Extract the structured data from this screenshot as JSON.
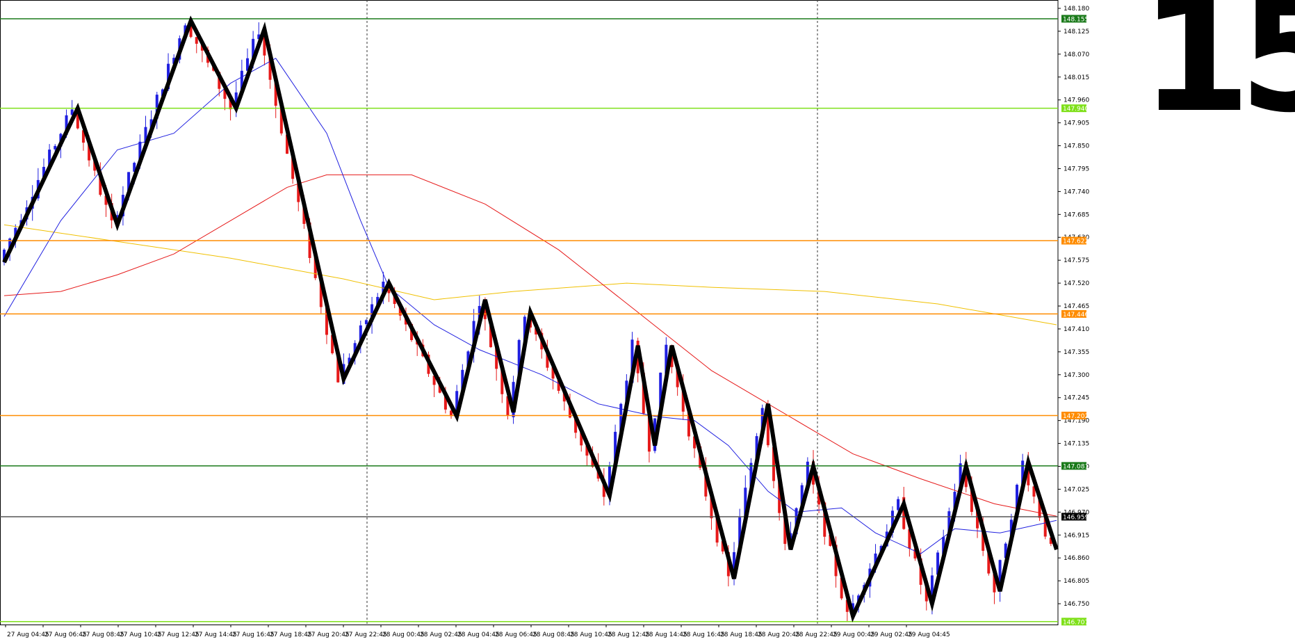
{
  "timeframe_label": "15",
  "chart_data": {
    "type": "candlestick",
    "ylim": [
      146.7,
      148.19
    ],
    "price_ticks": [
      "148.180",
      "148.125",
      "148.070",
      "148.015",
      "147.960",
      "147.905",
      "147.850",
      "147.795",
      "147.740",
      "147.685",
      "147.630",
      "147.575",
      "147.520",
      "147.465",
      "147.410",
      "147.355",
      "147.300",
      "147.245",
      "147.190",
      "147.135",
      "147.080",
      "147.025",
      "146.970",
      "146.915",
      "146.860",
      "146.805",
      "146.750"
    ],
    "time_labels": [
      "27 Aug 04:45",
      "27 Aug 06:45",
      "27 Aug 08:45",
      "27 Aug 10:45",
      "27 Aug 12:45",
      "27 Aug 14:45",
      "27 Aug 16:45",
      "27 Aug 18:45",
      "27 Aug 20:45",
      "27 Aug 22:45",
      "28 Aug 00:45",
      "28 Aug 02:45",
      "28 Aug 04:45",
      "28 Aug 06:45",
      "28 Aug 08:45",
      "28 Aug 10:45",
      "28 Aug 12:45",
      "28 Aug 14:45",
      "28 Aug 16:45",
      "28 Aug 18:45",
      "28 Aug 20:45",
      "28 Aug 22:45",
      "29 Aug 00:45",
      "29 Aug 02:45",
      "29 Aug 04:45"
    ],
    "level_lines": [
      {
        "price": 148.155,
        "label": "148.155",
        "color": "#1a7a1a"
      },
      {
        "price": 147.94,
        "label": "147.940",
        "color": "#7fe01a"
      },
      {
        "price": 147.622,
        "label": "147.622",
        "color": "#ff8c00"
      },
      {
        "price": 147.446,
        "label": "147.446",
        "color": "#ff8c00"
      },
      {
        "price": 147.202,
        "label": "147.202",
        "color": "#ff8c00"
      },
      {
        "price": 147.081,
        "label": "147.081",
        "color": "#1a7a1a"
      },
      {
        "price": 146.959,
        "label": "146.959",
        "color": "#555555",
        "current": true
      },
      {
        "price": 146.707,
        "label": "146.707",
        "color": "#7fe01a"
      }
    ],
    "zigzag": [
      [
        0,
        147.57
      ],
      [
        13,
        147.94
      ],
      [
        20,
        147.66
      ],
      [
        33,
        148.15
      ],
      [
        41,
        147.94
      ],
      [
        46,
        148.13
      ],
      [
        60,
        147.29
      ],
      [
        68,
        147.52
      ],
      [
        80,
        147.2
      ],
      [
        85,
        147.48
      ],
      [
        90,
        147.21
      ],
      [
        93,
        147.45
      ],
      [
        107,
        147.01
      ],
      [
        112,
        147.37
      ],
      [
        115,
        147.13
      ],
      [
        118,
        147.37
      ],
      [
        129,
        146.81
      ],
      [
        135,
        147.23
      ],
      [
        139,
        146.88
      ],
      [
        143,
        147.08
      ],
      [
        150,
        146.72
      ],
      [
        159,
        146.99
      ],
      [
        164,
        146.75
      ],
      [
        170,
        147.08
      ],
      [
        176,
        146.78
      ],
      [
        181,
        147.09
      ],
      [
        186,
        146.88
      ]
    ],
    "ma_blue": [
      [
        0,
        147.44
      ],
      [
        10,
        147.67
      ],
      [
        20,
        147.84
      ],
      [
        30,
        147.88
      ],
      [
        40,
        148.0
      ],
      [
        48,
        148.06
      ],
      [
        57,
        147.88
      ],
      [
        63,
        147.67
      ],
      [
        68,
        147.51
      ],
      [
        76,
        147.42
      ],
      [
        84,
        147.36
      ],
      [
        95,
        147.3
      ],
      [
        105,
        147.23
      ],
      [
        115,
        147.2
      ],
      [
        122,
        147.19
      ],
      [
        128,
        147.13
      ],
      [
        135,
        147.02
      ],
      [
        140,
        146.97
      ],
      [
        148,
        146.98
      ],
      [
        154,
        146.92
      ],
      [
        162,
        146.87
      ],
      [
        168,
        146.93
      ],
      [
        176,
        146.92
      ],
      [
        186,
        146.95
      ]
    ],
    "ma_red": [
      [
        0,
        147.49
      ],
      [
        10,
        147.5
      ],
      [
        20,
        147.54
      ],
      [
        30,
        147.59
      ],
      [
        40,
        147.67
      ],
      [
        50,
        147.75
      ],
      [
        57,
        147.78
      ],
      [
        72,
        147.78
      ],
      [
        85,
        147.71
      ],
      [
        98,
        147.6
      ],
      [
        112,
        147.45
      ],
      [
        125,
        147.31
      ],
      [
        135,
        147.23
      ],
      [
        150,
        147.11
      ],
      [
        162,
        147.05
      ],
      [
        175,
        146.99
      ],
      [
        186,
        146.96
      ]
    ],
    "ma_yellow": [
      [
        0,
        147.66
      ],
      [
        20,
        147.62
      ],
      [
        40,
        147.58
      ],
      [
        60,
        147.53
      ],
      [
        76,
        147.48
      ],
      [
        90,
        147.5
      ],
      [
        110,
        147.52
      ],
      [
        125,
        147.51
      ],
      [
        145,
        147.5
      ],
      [
        165,
        147.47
      ],
      [
        186,
        147.42
      ]
    ]
  }
}
